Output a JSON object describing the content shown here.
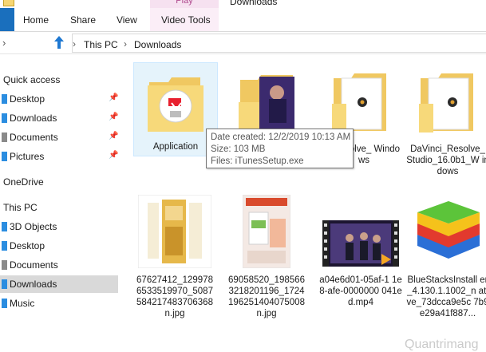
{
  "window": {
    "title": "Downloads",
    "context_tab": "Play"
  },
  "ribbon": {
    "tabs": [
      "Home",
      "Share",
      "View",
      "Video Tools"
    ]
  },
  "address": {
    "crumbs": [
      "This PC",
      "Downloads"
    ]
  },
  "nav": {
    "quick_access": "Quick access",
    "quick_items": [
      {
        "label": "Desktop",
        "pinned": true
      },
      {
        "label": "Downloads",
        "pinned": true
      },
      {
        "label": "Documents",
        "pinned": true
      },
      {
        "label": "Pictures",
        "pinned": true
      }
    ],
    "onedrive": "OneDrive",
    "this_pc": "This PC",
    "pc_items": [
      "3D Objects",
      "Desktop",
      "Documents",
      "Downloads",
      "Music"
    ],
    "selected": "Downloads"
  },
  "files": [
    {
      "name": "Application",
      "type": "folder-itunes"
    },
    {
      "name": "",
      "type": "folder-photo"
    },
    {
      "name": "_Resolve_ Windows",
      "type": "folder-davinci"
    },
    {
      "name": "DaVinci_Resolve_ Studio_16.0b1_W indows",
      "type": "folder-davinci"
    },
    {
      "name": "67627412_129978 6533519970_5087 584217483706368 n.jpg",
      "type": "image-yellow"
    },
    {
      "name": "69058520_198566 3218201196_1724 196251404075008 n.jpg",
      "type": "image-product"
    },
    {
      "name": "a04e6d01-05af-1 1e8-afe-0000000 041ed.mp4",
      "type": "video"
    },
    {
      "name": "BlueStacksInstall er_4.130.1.1002_n ative_73dcca9e5c 7b9e29a41f887...",
      "type": "bluestacks"
    }
  ],
  "tooltip": {
    "line1": "Date created: 12/2/2019 10:13 AM",
    "line2": "Size: 103 MB",
    "line3": "Files: iTunesSetup.exe"
  },
  "watermark": "Quantrimang"
}
